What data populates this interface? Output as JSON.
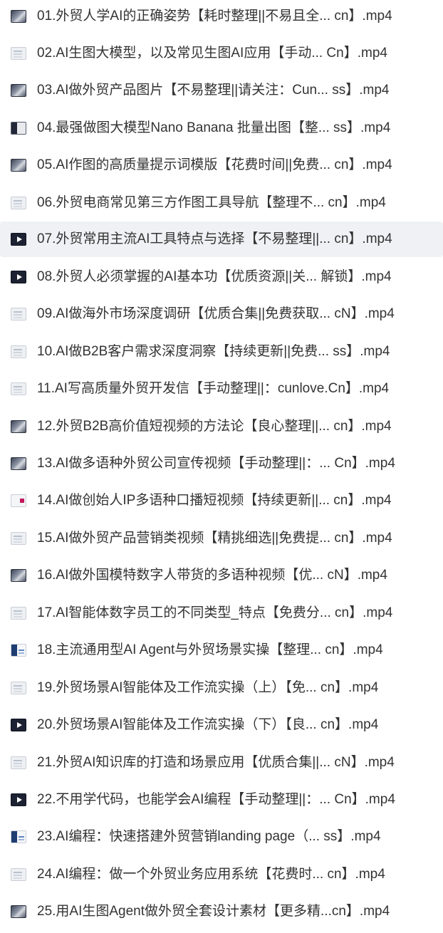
{
  "file_list": {
    "selected_index": 6,
    "items": [
      {
        "name": "01.外贸人学AI的正确姿势【耗时整理||不易且全... cn】.mp4",
        "thumb_icon": "video-thumbnail-icon"
      },
      {
        "name": "02.AI生图大模型，以及常见生图AI应用【手动... Cn】.mp4",
        "thumb_icon": "video-thumbnail-icon"
      },
      {
        "name": "03.AI做外贸产品图片【不易整理||请关注：Cun... ss】.mp4",
        "thumb_icon": "video-thumbnail-icon"
      },
      {
        "name": "04.最强做图大模型Nano Banana 批量出图【整... ss】.mp4",
        "thumb_icon": "video-thumbnail-icon"
      },
      {
        "name": "05.AI作图的高质量提示词模版【花费时间||免费... cn】.mp4",
        "thumb_icon": "video-thumbnail-icon"
      },
      {
        "name": "06.外贸电商常见第三方作图工具导航【整理不... cn】.mp4",
        "thumb_icon": "video-thumbnail-icon"
      },
      {
        "name": "07.外贸常用主流AI工具特点与选择【不易整理||... cn】.mp4",
        "thumb_icon": "video-thumbnail-icon"
      },
      {
        "name": "08.外贸人必须掌握的AI基本功【优质资源||关... 解锁】.mp4",
        "thumb_icon": "video-thumbnail-icon"
      },
      {
        "name": "09.AI做海外市场深度调研【优质合集||免费获取... cN】.mp4",
        "thumb_icon": "video-thumbnail-icon"
      },
      {
        "name": "10.AI做B2B客户需求深度洞察【持续更新||免费... ss】.mp4",
        "thumb_icon": "video-thumbnail-icon"
      },
      {
        "name": "11.AI写高质量外贸开发信【手动整理||：cunlove.Cn】.mp4",
        "thumb_icon": "video-thumbnail-icon"
      },
      {
        "name": "12.外贸B2B高价值短视频的方法论【良心整理||... cn】.mp4",
        "thumb_icon": "video-thumbnail-icon"
      },
      {
        "name": "13.AI做多语种外贸公司宣传视频【手动整理||：... Cn】.mp4",
        "thumb_icon": "video-thumbnail-icon"
      },
      {
        "name": "14.AI做创始人IP多语种口播短视频【持续更新||... cn】.mp4",
        "thumb_icon": "video-thumbnail-icon"
      },
      {
        "name": "15.AI做外贸产品营销类视频【精挑细选||免费提... cn】.mp4",
        "thumb_icon": "video-thumbnail-icon"
      },
      {
        "name": "16.AI做外国模特数字人带货的多语种视频【优... cN】.mp4",
        "thumb_icon": "video-thumbnail-icon"
      },
      {
        "name": "17.AI智能体数字员工的不同类型_特点【免费分... cn】.mp4",
        "thumb_icon": "video-thumbnail-icon"
      },
      {
        "name": "18.主流通用型AI Agent与外贸场景实操【整理... cn】.mp4",
        "thumb_icon": "video-thumbnail-icon"
      },
      {
        "name": "19.外贸场景AI智能体及工作流实操（上）【免... cn】.mp4",
        "thumb_icon": "video-thumbnail-icon"
      },
      {
        "name": "20.外贸场景AI智能体及工作流实操（下）【良... cn】.mp4",
        "thumb_icon": "video-thumbnail-icon"
      },
      {
        "name": "21.外贸AI知识库的打造和场景应用【优质合集||... cN】.mp4",
        "thumb_icon": "video-thumbnail-icon"
      },
      {
        "name": "22.不用学代码，也能学会AI编程【手动整理||：... Cn】.mp4",
        "thumb_icon": "video-thumbnail-icon"
      },
      {
        "name": "23.AI编程：快速搭建外贸营销landing page（... ss】.mp4",
        "thumb_icon": "video-thumbnail-icon"
      },
      {
        "name": "24.AI编程：做一个外贸业务应用系统【花费时... cn】.mp4",
        "thumb_icon": "video-thumbnail-icon"
      },
      {
        "name": "25.用AI生图Agent做外贸全套设计素材【更多精...cn】.mp4",
        "thumb_icon": "video-thumbnail-icon"
      }
    ]
  }
}
